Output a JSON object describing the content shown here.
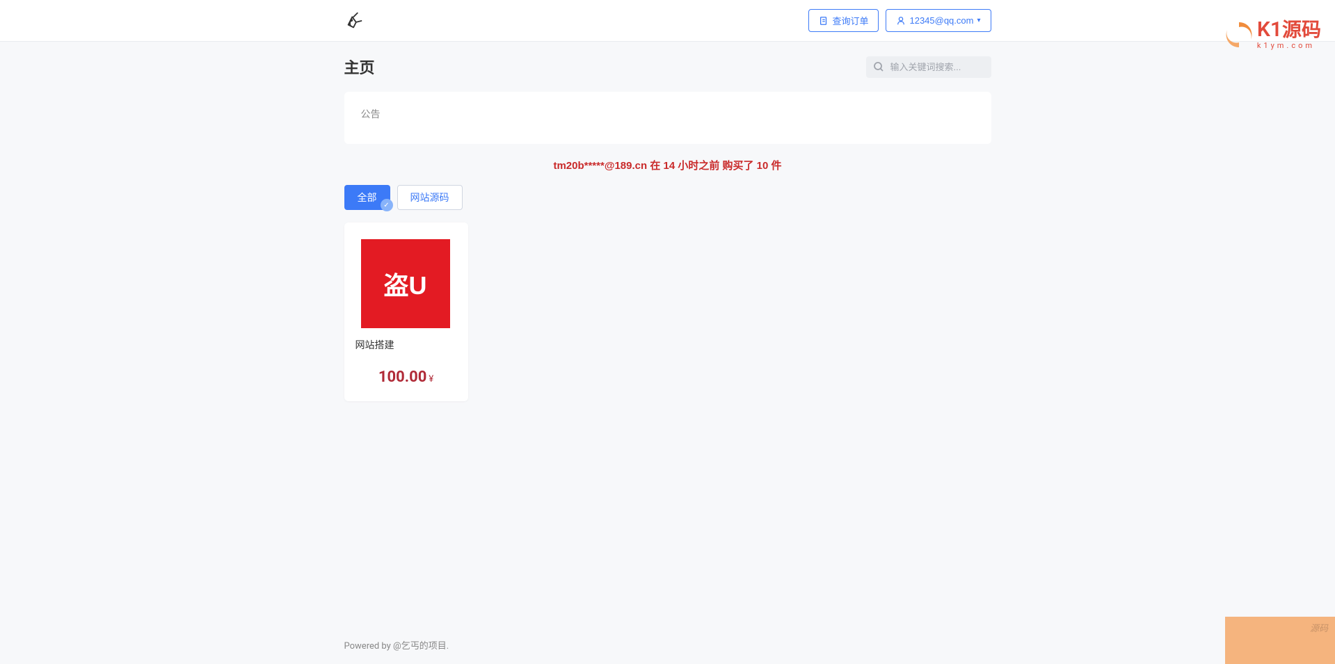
{
  "header": {
    "query_order_label": "查询订单",
    "user_label": "12345@qq.com"
  },
  "brand": {
    "k1": "K1",
    "chinese": "源码",
    "sub": "k1ym.com"
  },
  "page": {
    "title": "主页",
    "search_placeholder": "输入关键词搜索...",
    "announce_label": "公告",
    "ticker": "tm20b*****@189.cn 在 14 小时之前 购买了 10 件"
  },
  "tabs": {
    "all": "全部",
    "website_source": "网站源码"
  },
  "product": {
    "image_text": "盗U",
    "title": "网站搭建",
    "price": "100.00",
    "currency": "¥"
  },
  "footer": {
    "text": "Powered by @乞丐的项目."
  },
  "notch": {
    "text": "源码"
  }
}
